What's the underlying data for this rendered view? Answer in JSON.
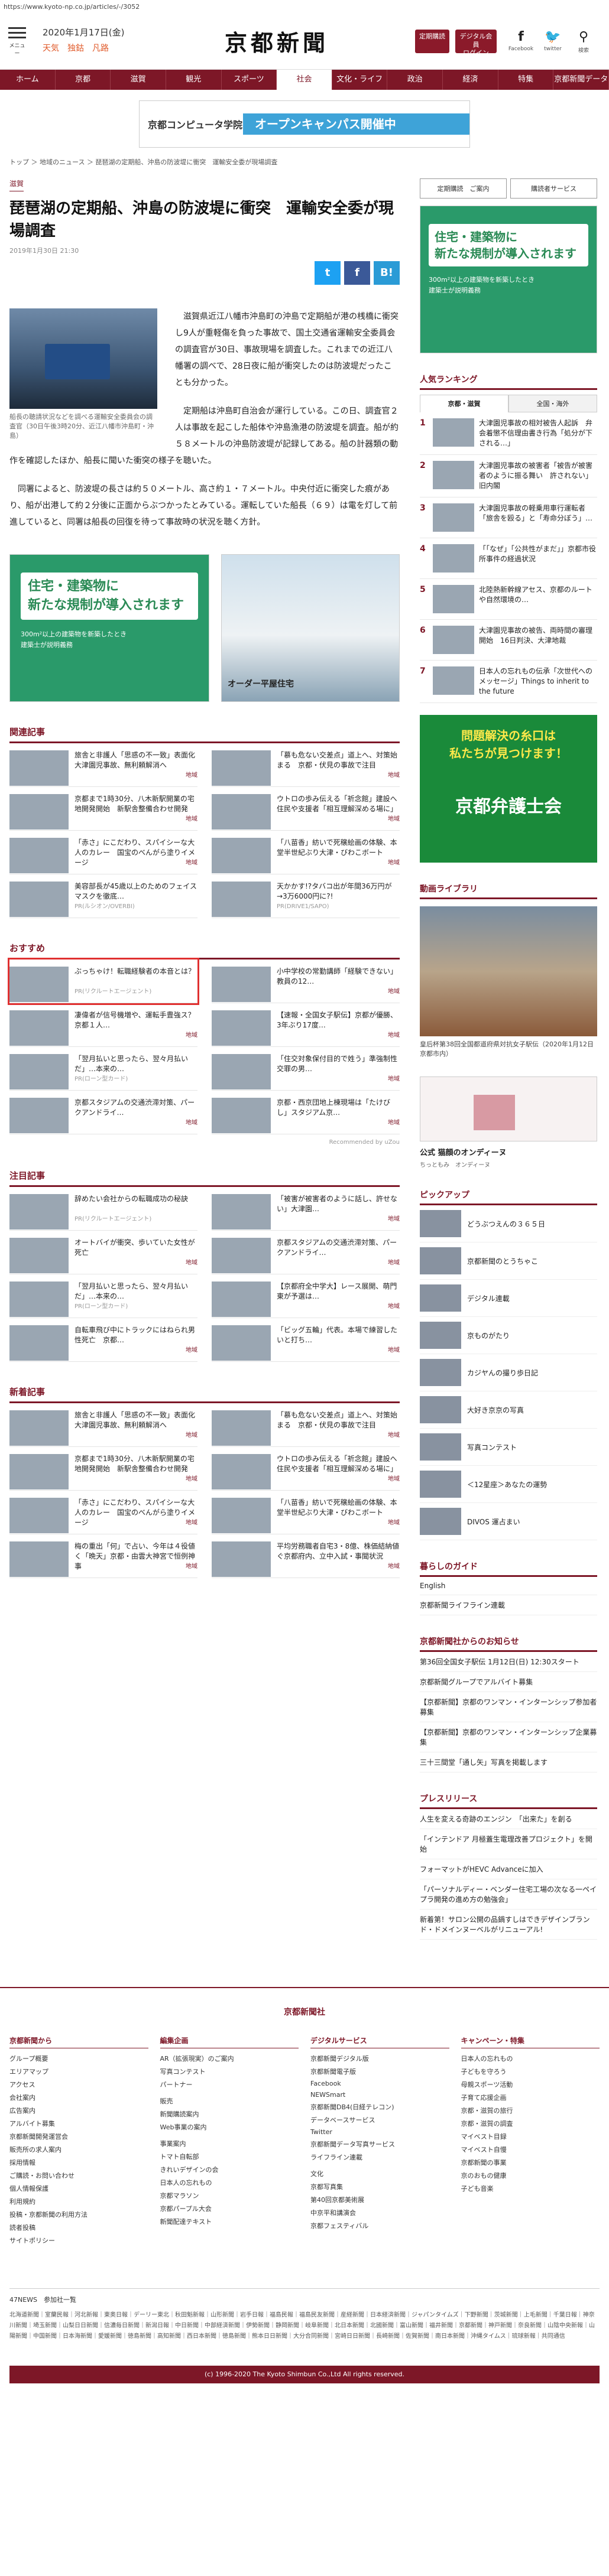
{
  "url": "https://www.kyoto-np.co.jp/articles/-/3052",
  "header": {
    "menu_label": "メニュー",
    "date": "2020年1月17日(金)",
    "weather": "天気　独鈷　凡路",
    "logo": "京都新聞",
    "btn_subscribe": "定期購読",
    "btn_digital": "デジタル会員\nログイン",
    "facebook": "Facebook",
    "twitter": "twitter",
    "search": "検索"
  },
  "nav": [
    "ホーム",
    "京都",
    "滋賀",
    "観光",
    "スポーツ",
    "社会",
    "文化・ライフ",
    "政治",
    "経済",
    "特集",
    "京都新聞データ"
  ],
  "top_banner": {
    "left": "京都コンピュータ学院",
    "right": "オープンキャンパス開催中"
  },
  "breadcrumb": "トップ ＞ 地域のニュース ＞ 琵琶湖の定期船、沖島の防波堤に衝突　運輸安全委が現場調査",
  "article": {
    "category": "滋賀",
    "title": "琵琶湖の定期船、沖島の防波堤に衝突　運輸安全委が現場調査",
    "date": "2019年1月30日 21:30",
    "caption": "船長の聴請状況などを調べる運輸安全委員会の調査官（30日午後3時20分、近江八幡市沖島町・沖島）",
    "p1": "滋賀県近江八幡市沖島町の沖島で定期船が港の桟橋に衝突し9人が重軽傷を負った事故で、国土交通省運輸安全委員会の調査官が30日、事故現場を調査した。これまでの近江八幡署の調べで、28日夜に船が衝突したのは防波堤だったことも分かった。",
    "p2": "定期船は沖島町自治会が運行している。この日、調査官２人は事故を起こした船体や沖島漁港の防波堤を調査。船が約５８メートルの沖島防波堤が記録してある。船の計器類の動作を確認したほか、船長に聞いた衝突の様子を聴いた。",
    "p3": "同署によると、防波堤の長さは約５０メートル、高さ約１・７メートル。中央付近に衝突した痕があり、船が出港して約２分後に正面からぶつかったとみている。運転していた船長（６９）は電を灯して前進していると、同署は船長の回復を待って事故時の状況を聴く方針。"
  },
  "share": {
    "tw": "t",
    "fb": "f",
    "bl": "B!"
  },
  "ads": {
    "green_big": "住宅・建築物に\n新たな規制が導入されます",
    "green_small": "300m²以上の建築物を新築したとき\n建築士が説明義務",
    "house_label": "オーダー平屋住宅"
  },
  "related": {
    "heading": "関連記事",
    "items": [
      {
        "title": "旅舎と非護人「思惑の不一致」表面化　大津園児事故、無利頼解消へ",
        "tag": "地域"
      },
      {
        "title": "「慕も危ない交差点」道上へ、対策始まる　京都・伏見の事故で注目",
        "tag": "地域"
      },
      {
        "title": "京都まで1時30分、八木新駅開業の宅地開発開始　新駅舎整備合わせ開発",
        "tag": "地域"
      },
      {
        "title": "ウトロの歩み伝える「祈念館」建設へ　住民や支援者「相互理解深める場に」",
        "tag": "地域"
      },
      {
        "title": "「赤さ」にこだわり、スパイシーな大人のカレー　国宝のべんがら塗りイメージ",
        "tag": "地域"
      },
      {
        "title": "「八苗香」紡いで死穣絵画の体験、本堂半世紀ぶり大津・びわこボート",
        "tag": "地域"
      },
      {
        "title": "美容部長が45歳以上のためのフェイスマスクを徹底…",
        "tag": "PR(ルシオン/OVERBI)"
      },
      {
        "title": "天かかす!?タバコ出が年間36万円が→3万6000円に?!",
        "tag": "PR(DRIVE1/SAPO)"
      }
    ]
  },
  "recommend": {
    "heading": "おすすめ",
    "items": [
      {
        "title": "ぶっちゃけ！転職経験者の本音とは？",
        "tag": "PR(リクルートエージェント)",
        "red": true
      },
      {
        "title": "小中学校の常勤講師「経験できない」　教員の12…",
        "tag": "地域"
      },
      {
        "title": "凄偉者が信号機増や、運転手豊強ス？　京都１人…",
        "tag": "地域"
      },
      {
        "title": "【速報・全国女子駅伝】京都が優勝、3年ぶり17度…",
        "tag": "地域"
      },
      {
        "title": "「翌月払いと思ったら、翌々月払いだ」…本来の…",
        "tag": "PR(ローン型カード)"
      },
      {
        "title": "「住交対象保付目的で姓う」準強制性交罪の男…",
        "tag": "地域"
      },
      {
        "title": "京都スタジアムの交通渋滞対策、パークアンドライ…",
        "tag": "地域"
      },
      {
        "title": "京都・西京団地上棟現場は「たけびし」スタジアム京…",
        "tag": "地域"
      }
    ],
    "credit": "Recommended by uZou"
  },
  "popular": {
    "heading": "注目記事",
    "items": [
      {
        "title": "辞めたい会社からの転職成功の秘訣",
        "tag": "PR(リクルートエージェント)"
      },
      {
        "title": "「被害が被害者のように話し、許せない」大津園…",
        "tag": "地域"
      },
      {
        "title": "オートバイが衝突、歩いていた女性が死亡",
        "tag": "地域"
      },
      {
        "title": "京都スタジアムの交通渋滞対策、パークアンドライ…",
        "tag": "地域"
      },
      {
        "title": "「翌月払いと思ったら、翌々月払いだ」…本来の…",
        "tag": "PR(ローン型カード)"
      },
      {
        "title": "【京都府全中学大】レース展開、萌門東が予選は…",
        "tag": "地域"
      },
      {
        "title": "自転車飛び中にトラックにはねられ男性死亡　京都…",
        "tag": "地域"
      },
      {
        "title": "「ビッグ五輪」代表。本場で練習したいと打ち…",
        "tag": "地域"
      }
    ]
  },
  "latest": {
    "heading": "新着記事",
    "items": [
      {
        "title": "旅舎と非護人「思惑の不一致」表面化　大津園児事故、無利頼解消へ",
        "tag": "地域"
      },
      {
        "title": "「慕も危ない交差点」道上へ、対策始まる　京都・伏見の事故で注目",
        "tag": "地域"
      },
      {
        "title": "京都まで1時30分、八木新駅開業の宅地開発開始　新駅舎整備合わせ開発",
        "tag": "地域"
      },
      {
        "title": "ウトロの歩み伝える「祈念館」建設へ　住民や支援者「相互理解深める場に」",
        "tag": "地域"
      },
      {
        "title": "「赤さ」にこだわり、スパイシーな大人のカレー　国宝のべんがら塗りイメージ",
        "tag": "地域"
      },
      {
        "title": "「八苗香」紡いで死穣絵画の体験、本堂半世紀ぶり大津・びわこボート",
        "tag": "地域"
      },
      {
        "title": "梅の重出「何」で占い、今年は４役値く「晩天」京都・由雲大神宮で恒例神事",
        "tag": "地域"
      },
      {
        "title": "平均労務職者自宅3・8億、株価結納値ぐ京都府内、立中入試・事聞状況",
        "tag": "地域"
      }
    ]
  },
  "sidebar": {
    "btn_subscribe": "定期購読　ご案内",
    "btn_trial": "購読者サービス",
    "ad_big": "住宅・建築物に\n新たな規制が導入されます",
    "ad_small": "300m²以上の建築物を新築したとき\n建築士が説明義務",
    "ranking_heading": "人気ランキング",
    "rank_tabs": [
      "京都・滋賀",
      "全国・海外"
    ],
    "ranking": [
      "大津園児事故の相対被告人起訴　弁会着懲不信理由書き行為「処分が下される…」",
      "大津園児事故の被害者「被告が被害者のように振る舞い　許されない」旧内閣",
      "大津園児事故の軽乗用車行運転者「旅舎を殴る」と「寿命分ぼう」…",
      "「「なぜ」「公共性がまだ」」京都市役所事件の経過状況",
      "北陸熱新幹線アセス、京都のルートや自然環境の…",
      "大津園児事故の被告、両時間の審理開始　16日判決、大津地裁",
      "日本人の忘れもの伝承「次世代へのメッセージ」Things to inherit to the future"
    ],
    "bar_ad_top": "問題解決の糸口は\n私たちが見つけます！",
    "bar_ad_bottom": "京都弁護士会",
    "video_heading": "動画ライブラリ",
    "video_caption": "皇后杯第38回全国都道府県対抗女子駅伝（2020年1月12日　京都市内）",
    "cosme_title": "公式 猫顔のオンディーヌ",
    "cosme_sub": "ちっともみ　オンディーヌ",
    "pickup_heading": "ピックアップ",
    "pickup": [
      "どうぶつえんの３６５日",
      "京都新聞のとうちゃこ",
      "デジタル連載",
      "京ものがたり",
      "カジヤんの撮り歩日記",
      "大好き京京の写真",
      "写真コンテスト",
      "＜12星座＞あなたの運勢",
      "DIVOS 運占まい"
    ],
    "guide_heading": "暮らしのガイド",
    "guide": [
      "English",
      "京都新聞ライフライン連載"
    ],
    "notice_heading": "京都新聞社からのお知らせ",
    "notice": [
      "第36回全国女子駅伝 1月12日(日) 12:30スタート",
      "京都新聞グループでアルバイト募集",
      "【京都新聞】京都のワンマン・インターンシップ参加者募集",
      "【京都新聞】京都のワンマン・インターンシップ企業募集",
      "三十三間堂「通し矢」写真を掲載します"
    ],
    "press_heading": "プレスリリース",
    "press": [
      "人生を変える奇跡のエンジン　「出来た」を創る",
      "「インテンドア 月極蓋生電理改善プロジェクト」を開始",
      "フォーマットがHEVC Advanceに加入",
      "「パーソナルディー・ベンダー住宅工場の次なる一ペイプラ開発の進め方の勉強会」",
      "新着第！サロン公開の品鍋すしはできデザインブランド・ドメインヌーベルがリニューアル!"
    ]
  },
  "footer": {
    "company": "京都新聞社",
    "cols": [
      {
        "title": "京都新聞から",
        "items": [
          "グループ概要",
          "エリアマップ",
          "アクセス",
          "会社案内",
          "広告案内",
          "アルバイト募集",
          "京都新聞開発運営会",
          "販売所の求人案内",
          "採用情報",
          "ご購読・お問い合わせ",
          "個人情報保護",
          "利用規約",
          "投稿・京都新聞の利用方法",
          "読者投稿",
          "サイトポリシー"
        ]
      },
      {
        "title": "編集企画",
        "items": [
          "AR（拡張現実）のご案内",
          "写真コンテスト",
          "パートナー",
          "",
          "販売",
          "新聞購読案内",
          "Web事業の案内",
          "",
          "事業案内",
          "トマト自転部",
          "きれいデザインの会",
          "日本人の忘れもの",
          "京都マラソン",
          "京都パープル大会",
          "新聞配達テキスト"
        ]
      },
      {
        "title": "デジタルサービス",
        "items": [
          "京都新聞デジタル版",
          "京都新聞電子版",
          "Facebook",
          "NEWSmart",
          "京都新聞DB4(日経テレコン)",
          "データベースサービス",
          "Twitter",
          "京都新聞データ写真サービス",
          "ライフライン連載",
          "",
          "文化",
          "京都写真集",
          "第40回京都美術展",
          "中京平和講演会",
          "京都フェスティバル"
        ]
      },
      {
        "title": "キャンペーン・特集",
        "items": [
          "日本人の忘れもの",
          "子どもを守ろう",
          "母親スポーツ活動",
          "子育て応援企画",
          "京都・滋賀の旅行",
          "京都・滋賀の調査",
          "マイベスト目録",
          "マイベスト自慢",
          "京都新聞の事業",
          "京のおもの健康",
          "子ども音楽",
          "",
          "",
          "",
          ""
        ]
      }
    ],
    "news47_label": "47NEWS　参加社一覧",
    "news47_list": "北海道新聞｜室蘭民報｜河北新報｜東奥日報｜デーリー東北｜秋田魁新報｜山形新聞｜岩手日報｜福島民報｜福島民友新聞｜産経新聞｜日本経済新聞｜ジャパンタイムズ｜下野新聞｜茨城新聞｜上毛新聞｜千葉日報｜神奈川新聞｜埼玉新聞｜山梨日日新聞｜信濃毎日新聞｜新潟日報｜中日新聞｜中部経済新聞｜伊勢新聞｜静岡新聞｜岐阜新聞｜北日本新聞｜北國新聞｜富山新聞｜福井新聞｜京都新聞｜神戸新聞｜奈良新聞｜山陰中央新報｜山陽新聞｜中国新聞｜日本海新聞｜愛媛新聞｜徳島新聞｜高知新聞｜西日本新聞｜徳島新聞｜熊本日日新聞｜大分合同新聞｜宮崎日日新聞｜長崎新聞｜佐賀新聞｜南日本新聞｜沖縄タイムス｜琉球新報｜共同通信",
    "copyright": "(c) 1996-2020 The Kyoto Shimbun Co.,Ltd All rights reserved."
  },
  "colors": {
    "brand": "#7d1727",
    "alert": "#e03030"
  }
}
